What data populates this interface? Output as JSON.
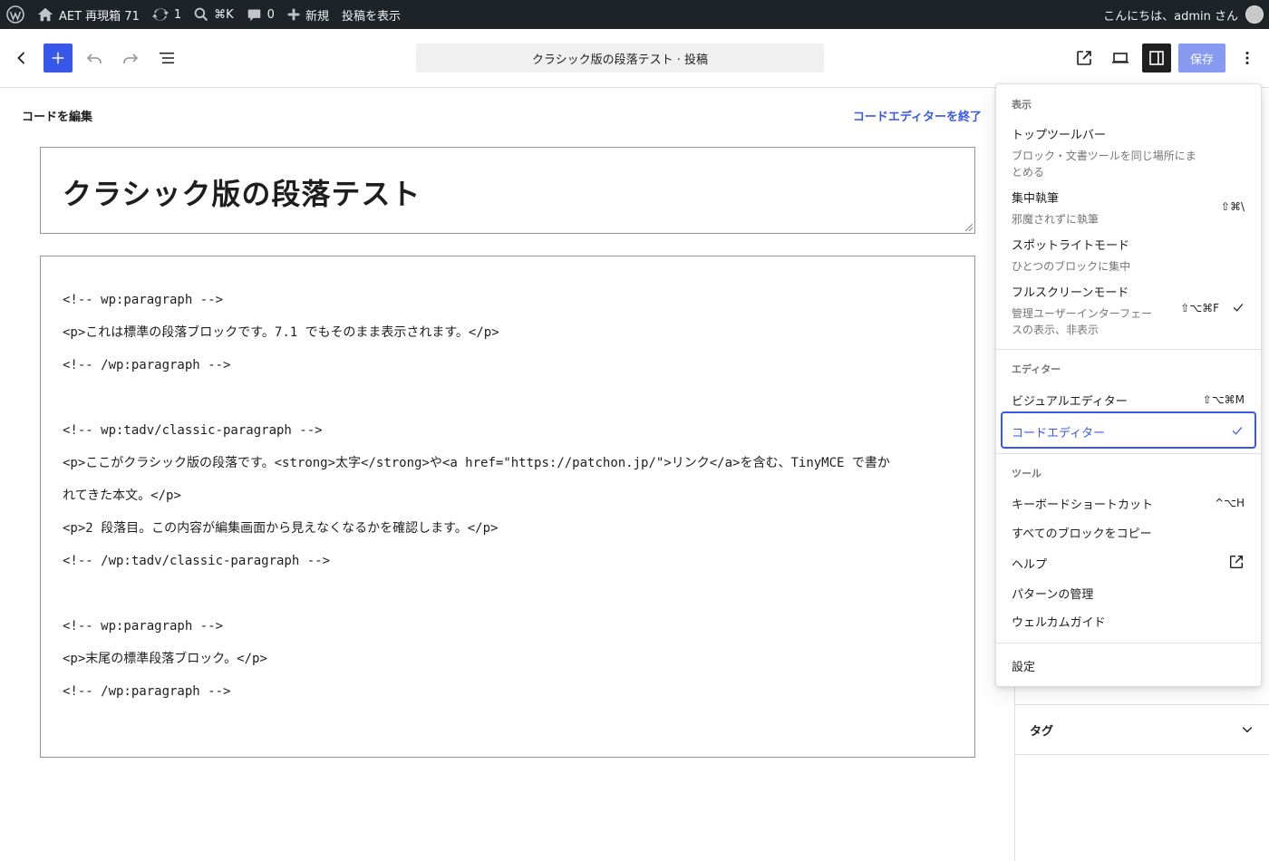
{
  "admin_bar": {
    "site_name": "AET 再現箱 71",
    "updates_count": "1",
    "search_shortcut": "⌘K",
    "comments_count": "0",
    "new_label": "新規",
    "view_post_label": "投稿を表示",
    "greeting": "こんにちは、admin さん"
  },
  "toolbar": {
    "document_title": "クラシック版の段落テスト · 投稿",
    "save_label": "保存"
  },
  "editor": {
    "header": "コードを編集",
    "exit_code_editor": "コードエディターを終了",
    "post_title": "クラシック版の段落テスト",
    "code_lines": [
      "<!-- wp:paragraph -->",
      "<p>これは標準の段落ブロックです。7.1 でもそのまま表示されます。</p>",
      "<!-- /wp:paragraph -->",
      "",
      "<!-- wp:tadv/classic-paragraph -->",
      "<p>ここがクラシック版の段落です。<strong>太字</strong>や<a href=\"https://patchon.jp/\">リンク</a>を含む、TinyMCE で書か",
      "れてきた本文。</p>",
      "<p>2 段落目。この内容が編集画面から見えなくなるかを確認します。</p>",
      "<!-- /wp:tadv/classic-paragraph -->",
      "",
      "<!-- wp:paragraph -->",
      "<p>末尾の標準段落ブロック。</p>",
      "<!-- /wp:paragraph -->"
    ]
  },
  "sidebar": {
    "tag_panel_label": "タグ"
  },
  "options_menu": {
    "view_group": {
      "label": "表示",
      "items": [
        {
          "label": "トップツールバー",
          "description": "ブロック・文書ツールを同じ場所にまとめる",
          "shortcut": ""
        },
        {
          "label": "集中執筆",
          "description": "邪魔されずに執筆",
          "shortcut": "⇧⌘\\"
        },
        {
          "label": "スポットライトモード",
          "description": "ひとつのブロックに集中",
          "shortcut": ""
        },
        {
          "label": "フルスクリーンモード",
          "description": "管理ユーザーインターフェースの表示、非表示",
          "shortcut": "⇧⌥⌘F"
        }
      ]
    },
    "editor_group": {
      "label": "エディター",
      "items": [
        {
          "label": "ビジュアルエディター",
          "shortcut": "⇧⌥⌘M"
        },
        {
          "label": "コードエディター",
          "shortcut": ""
        }
      ]
    },
    "tools_group": {
      "label": "ツール",
      "items": [
        {
          "label": "キーボードショートカット",
          "shortcut": "^⌥H"
        },
        {
          "label": "すべてのブロックをコピー",
          "shortcut": ""
        },
        {
          "label": "ヘルプ",
          "shortcut": ""
        },
        {
          "label": "パターンの管理",
          "shortcut": ""
        },
        {
          "label": "ウェルカムガイド",
          "shortcut": ""
        }
      ]
    },
    "preferences_label": "設定"
  }
}
